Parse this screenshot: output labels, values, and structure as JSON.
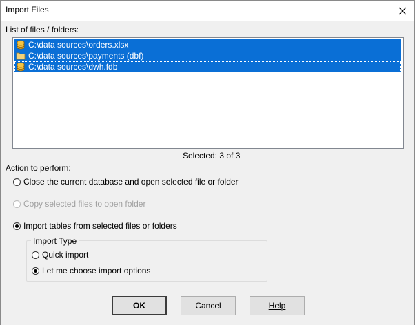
{
  "window": {
    "title": "Import Files"
  },
  "files": {
    "label": "List of files / folders:",
    "items": [
      {
        "path": "C:\\data sources\\orders.xlsx",
        "icon": "database-icon"
      },
      {
        "path": "C:\\data sources\\payments (dbf)",
        "icon": "folder-icon"
      },
      {
        "path": "C:\\data sources\\dwh.fdb",
        "icon": "database-icon"
      }
    ],
    "selected_text": "Selected: 3 of 3"
  },
  "action": {
    "label": "Action to perform:",
    "options": [
      {
        "label": "Close the current database and open selected file or folder",
        "checked": false,
        "enabled": true
      },
      {
        "label": "Copy selected files to open folder",
        "checked": false,
        "enabled": false
      },
      {
        "label": "Import tables from selected files or folders",
        "checked": true,
        "enabled": true
      }
    ]
  },
  "import_type": {
    "label": "Import Type",
    "options": [
      {
        "label": "Quick import",
        "checked": false
      },
      {
        "label": "Let me choose import options",
        "checked": true
      }
    ]
  },
  "buttons": {
    "ok": "OK",
    "cancel": "Cancel",
    "help": "Help"
  },
  "colors": {
    "selection": "#0a6fd6",
    "dialog_bg": "#f0f0f0"
  }
}
